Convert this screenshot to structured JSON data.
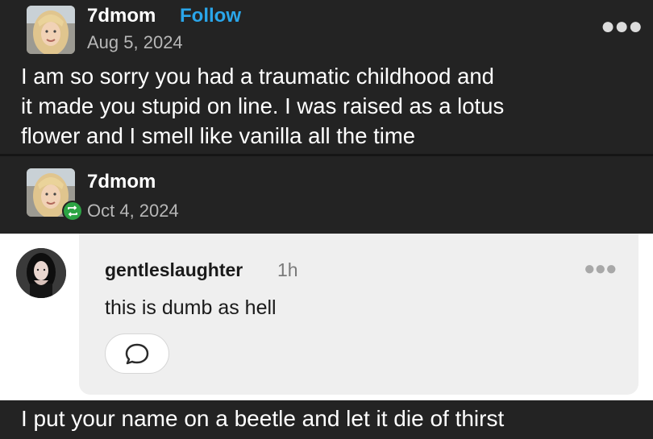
{
  "post": {
    "username": "7dmom",
    "follow_label": "Follow",
    "date": "Aug 5, 2024",
    "more_icon": "more-horizontal-icon",
    "body_lines": [
      "I am so sorry you had a traumatic childhood and",
      "it made you stupid on line. I was raised as a lotus",
      "flower and I smell like vanilla all the time"
    ]
  },
  "reblog": {
    "username": "7dmom",
    "date": "Oct 4, 2024",
    "badge_icon": "reblog-icon"
  },
  "comment": {
    "username": "gentleslaughter",
    "time": "1h",
    "text": "this is dumb as hell",
    "more_icon": "more-horizontal-icon",
    "reply_icon": "speech-bubble-icon"
  },
  "caption": "I put your name on a beetle and let it die of thirst",
  "colors": {
    "dark_bg": "#232323",
    "follow_blue": "#2aa6ea",
    "reblog_green": "#2ca444",
    "comment_card": "#efefef"
  }
}
